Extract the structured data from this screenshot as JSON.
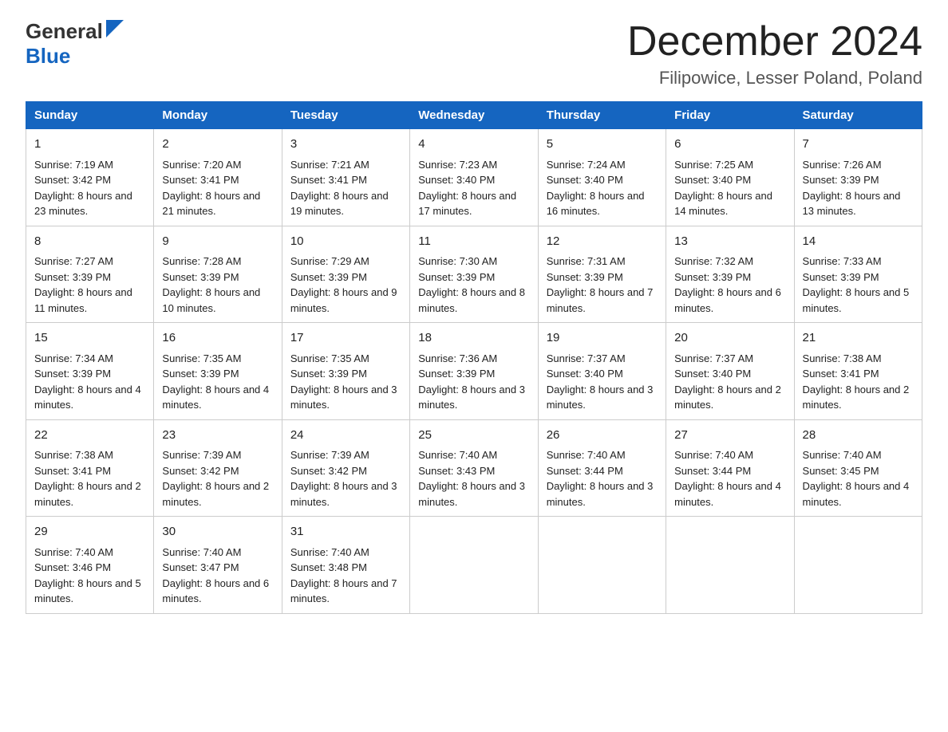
{
  "header": {
    "logo_general": "General",
    "logo_blue": "Blue",
    "main_title": "December 2024",
    "subtitle": "Filipowice, Lesser Poland, Poland"
  },
  "calendar": {
    "days_of_week": [
      "Sunday",
      "Monday",
      "Tuesday",
      "Wednesday",
      "Thursday",
      "Friday",
      "Saturday"
    ],
    "weeks": [
      [
        {
          "day": "1",
          "sunrise": "7:19 AM",
          "sunset": "3:42 PM",
          "daylight": "8 hours and 23 minutes."
        },
        {
          "day": "2",
          "sunrise": "7:20 AM",
          "sunset": "3:41 PM",
          "daylight": "8 hours and 21 minutes."
        },
        {
          "day": "3",
          "sunrise": "7:21 AM",
          "sunset": "3:41 PM",
          "daylight": "8 hours and 19 minutes."
        },
        {
          "day": "4",
          "sunrise": "7:23 AM",
          "sunset": "3:40 PM",
          "daylight": "8 hours and 17 minutes."
        },
        {
          "day": "5",
          "sunrise": "7:24 AM",
          "sunset": "3:40 PM",
          "daylight": "8 hours and 16 minutes."
        },
        {
          "day": "6",
          "sunrise": "7:25 AM",
          "sunset": "3:40 PM",
          "daylight": "8 hours and 14 minutes."
        },
        {
          "day": "7",
          "sunrise": "7:26 AM",
          "sunset": "3:39 PM",
          "daylight": "8 hours and 13 minutes."
        }
      ],
      [
        {
          "day": "8",
          "sunrise": "7:27 AM",
          "sunset": "3:39 PM",
          "daylight": "8 hours and 11 minutes."
        },
        {
          "day": "9",
          "sunrise": "7:28 AM",
          "sunset": "3:39 PM",
          "daylight": "8 hours and 10 minutes."
        },
        {
          "day": "10",
          "sunrise": "7:29 AM",
          "sunset": "3:39 PM",
          "daylight": "8 hours and 9 minutes."
        },
        {
          "day": "11",
          "sunrise": "7:30 AM",
          "sunset": "3:39 PM",
          "daylight": "8 hours and 8 minutes."
        },
        {
          "day": "12",
          "sunrise": "7:31 AM",
          "sunset": "3:39 PM",
          "daylight": "8 hours and 7 minutes."
        },
        {
          "day": "13",
          "sunrise": "7:32 AM",
          "sunset": "3:39 PM",
          "daylight": "8 hours and 6 minutes."
        },
        {
          "day": "14",
          "sunrise": "7:33 AM",
          "sunset": "3:39 PM",
          "daylight": "8 hours and 5 minutes."
        }
      ],
      [
        {
          "day": "15",
          "sunrise": "7:34 AM",
          "sunset": "3:39 PM",
          "daylight": "8 hours and 4 minutes."
        },
        {
          "day": "16",
          "sunrise": "7:35 AM",
          "sunset": "3:39 PM",
          "daylight": "8 hours and 4 minutes."
        },
        {
          "day": "17",
          "sunrise": "7:35 AM",
          "sunset": "3:39 PM",
          "daylight": "8 hours and 3 minutes."
        },
        {
          "day": "18",
          "sunrise": "7:36 AM",
          "sunset": "3:39 PM",
          "daylight": "8 hours and 3 minutes."
        },
        {
          "day": "19",
          "sunrise": "7:37 AM",
          "sunset": "3:40 PM",
          "daylight": "8 hours and 3 minutes."
        },
        {
          "day": "20",
          "sunrise": "7:37 AM",
          "sunset": "3:40 PM",
          "daylight": "8 hours and 2 minutes."
        },
        {
          "day": "21",
          "sunrise": "7:38 AM",
          "sunset": "3:41 PM",
          "daylight": "8 hours and 2 minutes."
        }
      ],
      [
        {
          "day": "22",
          "sunrise": "7:38 AM",
          "sunset": "3:41 PM",
          "daylight": "8 hours and 2 minutes."
        },
        {
          "day": "23",
          "sunrise": "7:39 AM",
          "sunset": "3:42 PM",
          "daylight": "8 hours and 2 minutes."
        },
        {
          "day": "24",
          "sunrise": "7:39 AM",
          "sunset": "3:42 PM",
          "daylight": "8 hours and 3 minutes."
        },
        {
          "day": "25",
          "sunrise": "7:40 AM",
          "sunset": "3:43 PM",
          "daylight": "8 hours and 3 minutes."
        },
        {
          "day": "26",
          "sunrise": "7:40 AM",
          "sunset": "3:44 PM",
          "daylight": "8 hours and 3 minutes."
        },
        {
          "day": "27",
          "sunrise": "7:40 AM",
          "sunset": "3:44 PM",
          "daylight": "8 hours and 4 minutes."
        },
        {
          "day": "28",
          "sunrise": "7:40 AM",
          "sunset": "3:45 PM",
          "daylight": "8 hours and 4 minutes."
        }
      ],
      [
        {
          "day": "29",
          "sunrise": "7:40 AM",
          "sunset": "3:46 PM",
          "daylight": "8 hours and 5 minutes."
        },
        {
          "day": "30",
          "sunrise": "7:40 AM",
          "sunset": "3:47 PM",
          "daylight": "8 hours and 6 minutes."
        },
        {
          "day": "31",
          "sunrise": "7:40 AM",
          "sunset": "3:48 PM",
          "daylight": "8 hours and 7 minutes."
        },
        null,
        null,
        null,
        null
      ]
    ]
  }
}
